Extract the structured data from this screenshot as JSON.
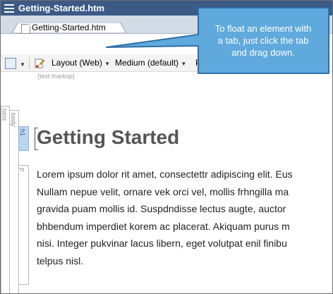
{
  "window": {
    "title": "Getting-Started.htm"
  },
  "tabs": [
    {
      "label": "Getting-Started.htm"
    }
  ],
  "toolbar": {
    "layout_label": "Layout (Web)",
    "medium_label": "Medium (default)",
    "partial_label": "P"
  },
  "structure_bar": {
    "markup_label": "(text markup)",
    "html_tag": "html",
    "body_tag": "body",
    "h1_tag": "h1",
    "p_tag": "p"
  },
  "document": {
    "heading": "Getting Started",
    "paragraph_lines": [
      "Lorem ipsum dolor rit amet, consectettr adipiscing elit. Eus",
      "Nullam nepue velit, ornare vek orci vel, mollis frhngilla ma",
      "gravida puam mollis id. Suspdndisse lectus augte, auctor",
      "bhbendum imperdiet korem ac placerat. Akiquam purus m",
      "nisi. Integer pukvinar lacus libern, eget volutpat enil finibu",
      "telpus nisl."
    ]
  },
  "callout": {
    "text_lines": [
      "To float an element with",
      "a tab, just click the tab",
      "and drag down."
    ]
  },
  "colors": {
    "titlebar": "#3b5a86",
    "callout_fill": "#5fa9dd",
    "callout_stroke": "#2f6fa6",
    "heading": "#555555",
    "h1_highlight": "#bcd5ee"
  }
}
